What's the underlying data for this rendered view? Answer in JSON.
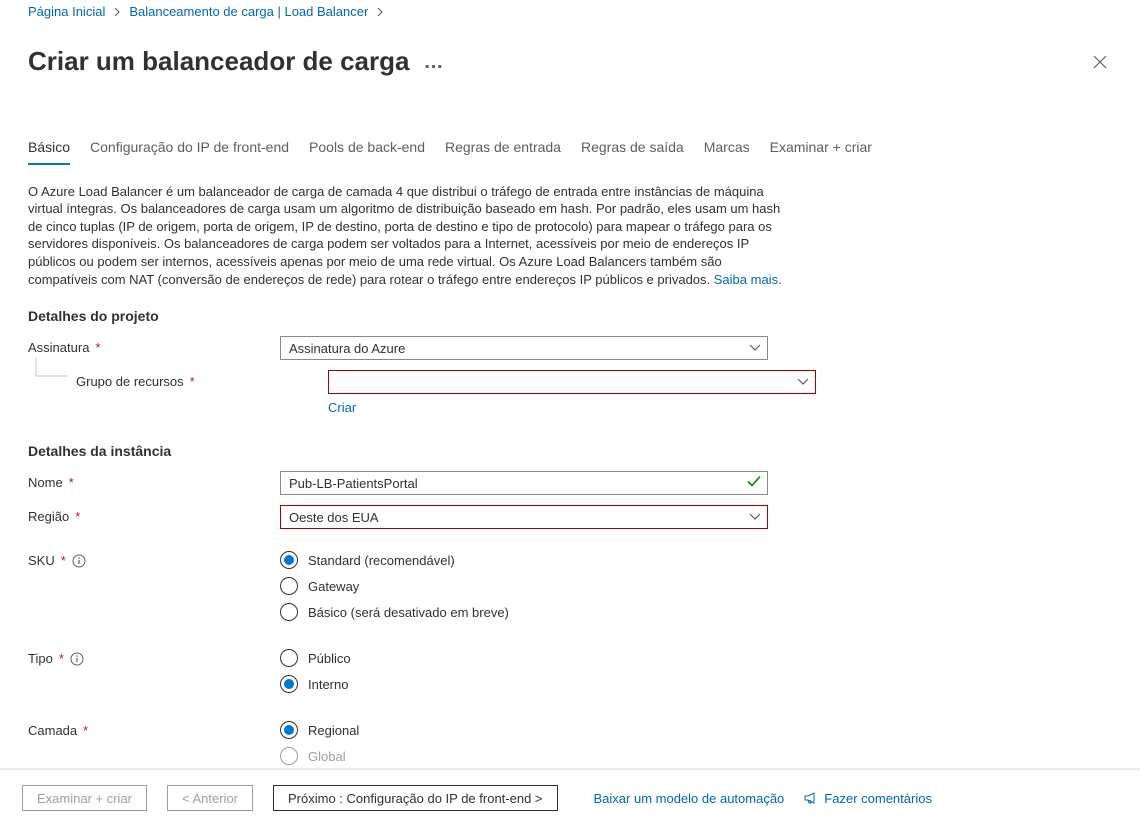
{
  "breadcrumb": {
    "home": "Página Inicial",
    "lb": "Balanceamento de carga | Load Balancer"
  },
  "page": {
    "title": "Criar um balanceador de carga",
    "more": "…"
  },
  "tabs": {
    "basic": "Básico",
    "frontend": "Configuração do IP de front-end",
    "backend": "Pools de back-end",
    "in_rules": "Regras de entrada",
    "out_rules": "Regras de saída",
    "tags": "Marcas",
    "review": "Examinar + criar"
  },
  "description": {
    "body": "O Azure Load Balancer é um balanceador de carga de camada 4 que distribui o tráfego de entrada entre instâncias de máquina virtual íntegras. Os balanceadores de carga usam um algoritmo de distribuição baseado em hash. Por padrão, eles usam um hash de cinco tuplas (IP de origem, porta de origem, IP de destino, porta de destino e tipo de protocolo) para mapear o tráfego para os servidores disponíveis. Os balanceadores de carga podem ser voltados para a Internet, acessíveis por meio de endereços IP públicos ou podem ser internos, acessíveis apenas por meio de uma rede virtual. Os Azure Load Balancers também são compatíveis com NAT (conversão de endereços de rede) para rotear o tráfego entre endereços IP públicos e privados. ",
    "learn_more": "Saiba mais."
  },
  "sections": {
    "project": "Detalhes do projeto",
    "instance": "Detalhes da instância"
  },
  "labels": {
    "subscription": "Assinatura",
    "rg": "Grupo de recursos",
    "name": "Nome",
    "region": "Região",
    "sku": "SKU",
    "type": "Tipo",
    "tier": "Camada"
  },
  "fields": {
    "subscription_value": "Assinatura do Azure",
    "rg_value": "",
    "rg_create": "Criar",
    "name_value": "Pub-LB-PatientsPortal",
    "region_value": "Oeste dos EUA",
    "sku_options": {
      "standard": "Standard (recomendável)",
      "gateway": "Gateway",
      "basic": "Básico (será desativado em breve)"
    },
    "sku_selected": "standard",
    "type_options": {
      "public": "Público",
      "internal": "Interno"
    },
    "type_selected": "internal",
    "tier_options": {
      "regional": "Regional",
      "global": "Global"
    },
    "tier_selected": "regional",
    "tier_disabled": "global"
  },
  "footer": {
    "review": "Examinar + criar",
    "prev": "< Anterior",
    "next": "Próximo : Configuração do IP de front-end  >",
    "download": "Baixar um modelo de automação",
    "feedback": "Fazer comentários"
  }
}
